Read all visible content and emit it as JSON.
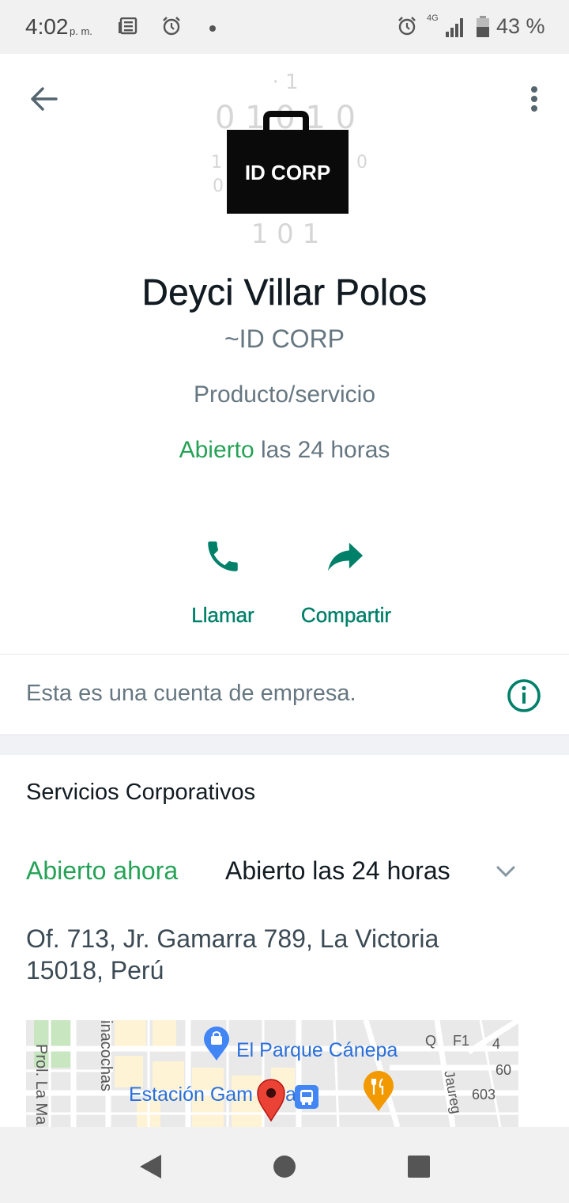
{
  "status_bar": {
    "time": "4:02",
    "ampm": "p. m.",
    "network": "4G",
    "battery": "43 %",
    "icons": [
      "news-icon",
      "alarm-icon",
      "dot-icon",
      "alarm-icon",
      "signal-icon",
      "battery-icon"
    ]
  },
  "header": {
    "back_icon": "arrow-left-icon",
    "menu_icon": "more-vert-icon"
  },
  "profile": {
    "logo_text": "ID CORP",
    "name": "Deyci Villar Polos",
    "push_name": "~ID CORP",
    "category": "Producto/servicio",
    "hours_status": "Abierto",
    "hours_rest": " las 24 horas"
  },
  "actions": [
    {
      "label": "Llamar",
      "icon": "phone-icon"
    },
    {
      "label": "Compartir",
      "icon": "share-icon"
    }
  ],
  "business_notice": {
    "text": "Esta es una cuenta de empresa.",
    "icon": "info-icon"
  },
  "details": {
    "description": "Servicios Corporativos",
    "open_now": "Abierto ahora",
    "hours": "Abierto las 24 horas",
    "expand_icon": "chevron-down-icon",
    "address": "Of. 713, Jr. Gamarra 789, La Victoria 15018, Perú"
  },
  "map": {
    "labels": {
      "park": "El Parque Cánepa",
      "station": "Estación Gam",
      "station_end": "a",
      "street_left": "Prol. La Ma",
      "street_vertical": "inacochas",
      "street_right": "Jaureg",
      "q": "Q",
      "f1": "F1",
      "n4": "4",
      "n60": "60",
      "n603": "603"
    }
  },
  "colors": {
    "accent": "#008069",
    "open_green": "#25a257",
    "secondary_text": "#667781"
  },
  "nav_bar": {
    "icons": [
      "back-triangle-icon",
      "home-circle-icon",
      "recents-square-icon"
    ]
  }
}
